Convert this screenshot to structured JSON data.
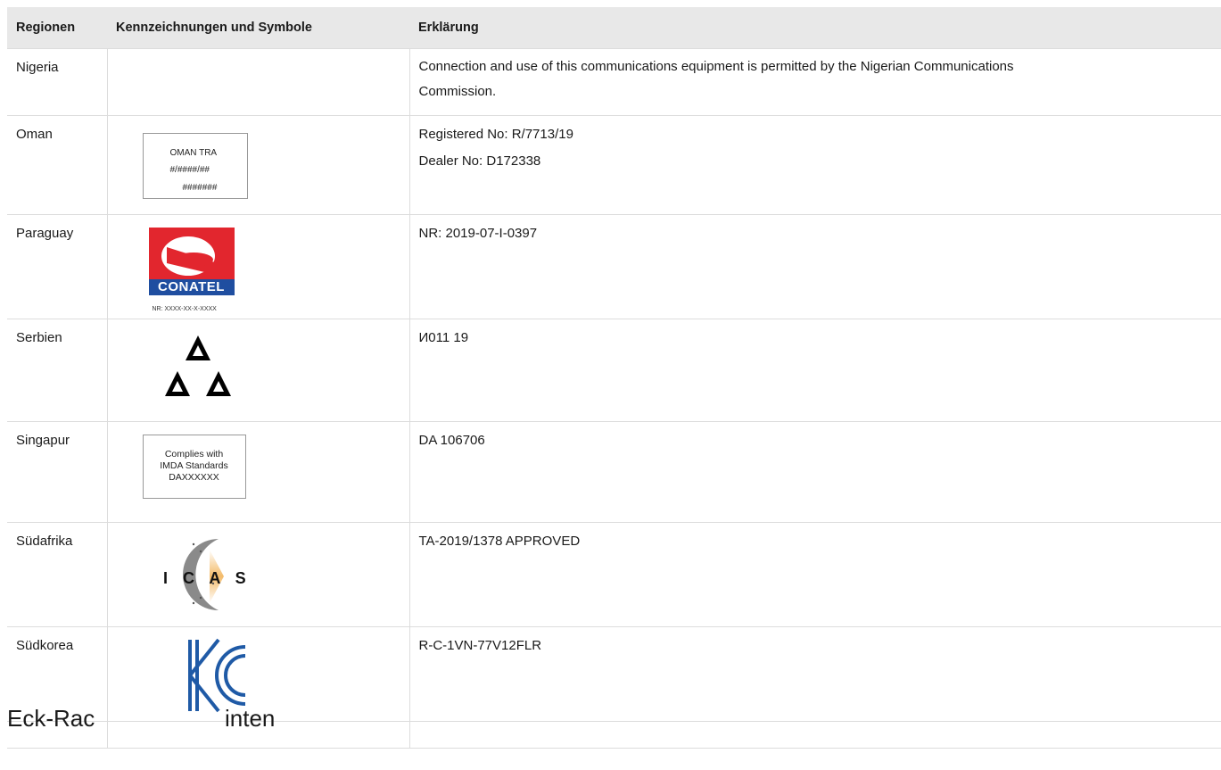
{
  "headers": {
    "region": "Regionen",
    "markings": "Kennzeichnungen und Symbole",
    "explanation": "Erklärung"
  },
  "rows": [
    {
      "region": "Nigeria",
      "explanation": [
        "Connection and use of this communications equipment is permitted by the Nigerian Communications",
        "Commission."
      ]
    },
    {
      "region": "Oman",
      "explanation": [
        "Registered No: R/7713/19",
        "Dealer No: D172338"
      ],
      "symbol_text": [
        "OMAN TRA",
        "#/####/##",
        "#######"
      ]
    },
    {
      "region": "Paraguay",
      "explanation": [
        "NR: 2019-07-I-0397"
      ],
      "symbol_text": [
        "CONATEL",
        "NR: XXXX-XX-X-XXXX"
      ]
    },
    {
      "region": "Serbien",
      "explanation": [
        "И011 19"
      ]
    },
    {
      "region": "Singapur",
      "explanation": [
        "DA 106706"
      ],
      "symbol_text": [
        "Complies with",
        "IMDA Standards",
        "DAXXXXXX"
      ]
    },
    {
      "region": "Südafrika",
      "explanation": [
        "TA-2019/1378 APPROVED"
      ],
      "symbol_text": [
        "I C A S A"
      ]
    },
    {
      "region": "Südkorea",
      "explanation": [
        "R-C-1VN-77V12FLR"
      ]
    }
  ],
  "overlay_heading": "Eck-Rac                  inten",
  "colors": {
    "header_bg": "#e8e8e8",
    "conatel_red": "#e2262e",
    "conatel_blue": "#1f4ea0",
    "kc_blue": "#1f5aa6"
  }
}
